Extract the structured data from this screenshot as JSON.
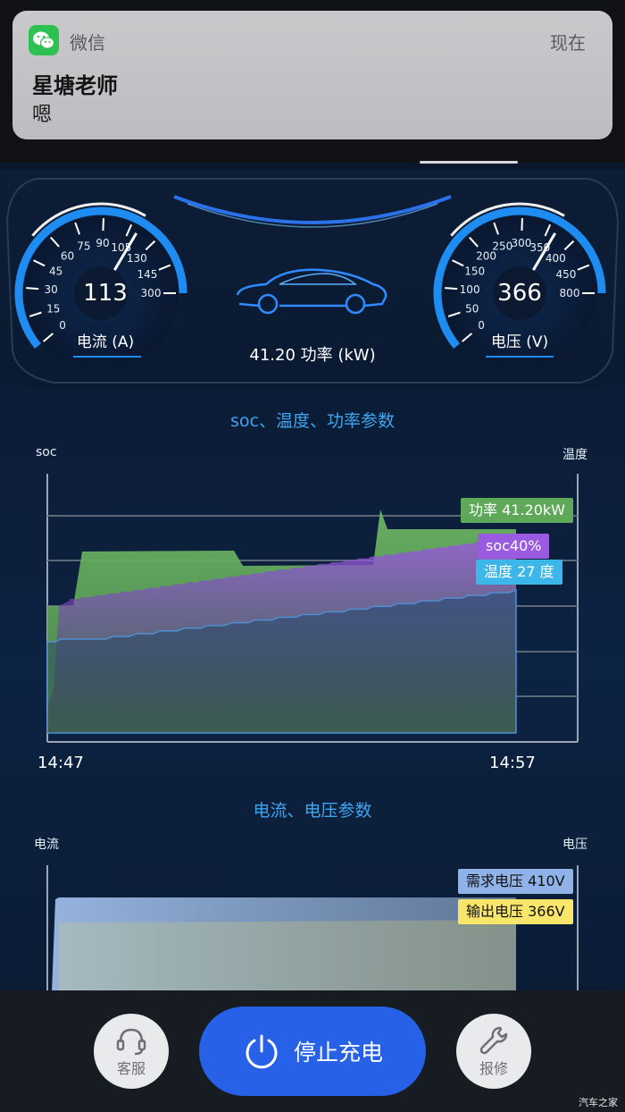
{
  "notification": {
    "app_name": "微信",
    "time": "现在",
    "sender": "星塘老师",
    "message": "嗯",
    "accent": "#2dc152"
  },
  "dashboard": {
    "current_gauge": {
      "value": "113",
      "label": "电流 (A)",
      "ticks": [
        "0",
        "15",
        "30",
        "45",
        "60",
        "75",
        "90",
        "105",
        "130",
        "145",
        "300"
      ]
    },
    "voltage_gauge": {
      "value": "366",
      "label": "电压 (V)",
      "ticks": [
        "0",
        "50",
        "100",
        "150",
        "200",
        "250",
        "300",
        "350",
        "400",
        "450",
        "800"
      ]
    },
    "power_text": "41.20 功率 (kW)"
  },
  "chart1": {
    "title": "soc、温度、功率参数",
    "left_axis": "soc",
    "right_axis": "温度",
    "start_time": "14:47",
    "end_time": "14:57",
    "legend": {
      "power": "功率 41.20kW",
      "soc": "soc40%",
      "temp": "温度 27 度"
    },
    "colors": {
      "power": "#5fa85a",
      "soc": "#9a5be0",
      "temp": "#3db6ea"
    }
  },
  "chart2": {
    "title": "电流、电压参数",
    "left_axis": "电流",
    "right_axis": "电压",
    "legend": {
      "demand": "需求电压 410V",
      "output": "输出电压 366V"
    },
    "colors": {
      "demand": "#8fb2e8",
      "output": "#f7e66a"
    }
  },
  "actions": {
    "service_label": "客服",
    "stop_label": "停止充电",
    "repair_label": "报修",
    "primary": "#2761e8"
  },
  "watermark": "汽车之家"
}
